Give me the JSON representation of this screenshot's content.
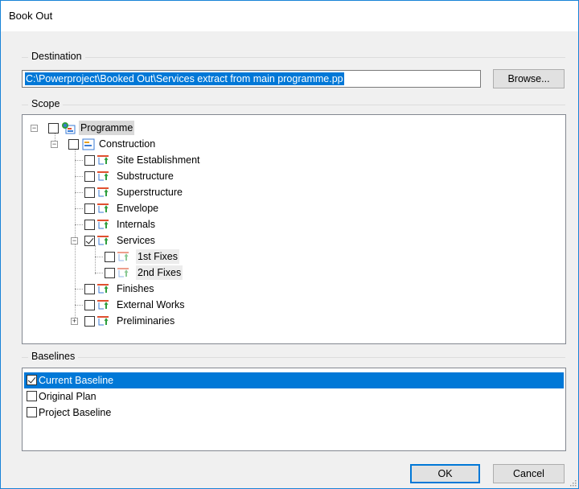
{
  "dialog": {
    "title": "Book Out"
  },
  "destination": {
    "group_label": "Destination",
    "path_value": "C:\\Powerproject\\Booked Out\\Services extract from main programme.pp",
    "browse_label": "Browse..."
  },
  "scope": {
    "group_label": "Scope",
    "root": "Programme",
    "construction": "Construction",
    "items": {
      "site": "Site Establishment",
      "substructure": "Substructure",
      "superstructure": "Superstructure",
      "envelope": "Envelope",
      "internals": "Internals",
      "services": "Services",
      "fixes1": "1st Fixes",
      "fixes2": "2nd Fixes",
      "finishes": "Finishes",
      "external": "External Works",
      "preliminaries": "Preliminaries"
    }
  },
  "baselines": {
    "group_label": "Baselines",
    "items": [
      "Current Baseline",
      "Original Plan",
      "Project Baseline"
    ],
    "checked": [
      true,
      false,
      false
    ]
  },
  "footer": {
    "ok_label": "OK",
    "cancel_label": "Cancel"
  },
  "colors": {
    "accent": "#0078d7",
    "border": "#1883d7",
    "icon_red": "#e05030",
    "icon_green": "#2e9e3e",
    "icon_blue": "#3a7bd5"
  }
}
